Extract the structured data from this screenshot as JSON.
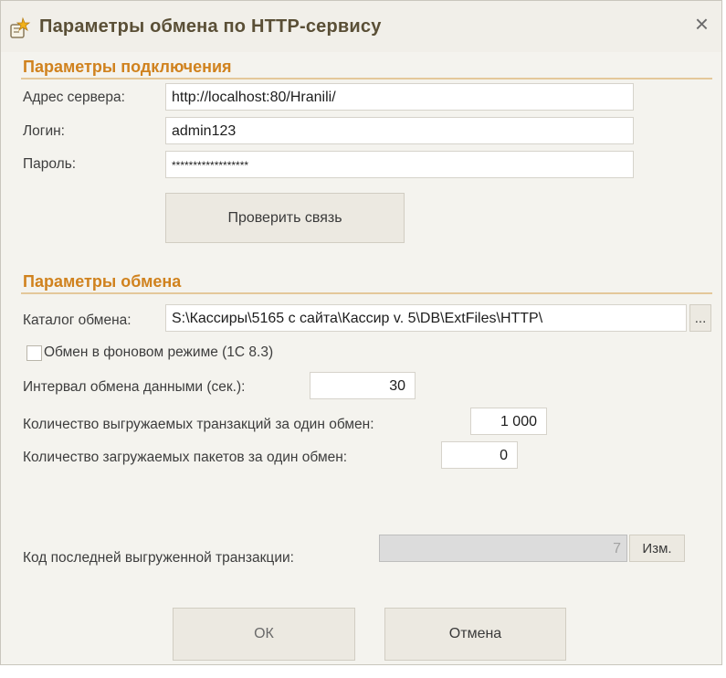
{
  "window": {
    "title": "Параметры обмена по HTTP-сервису",
    "close_label": "×"
  },
  "connection": {
    "section_title": "Параметры подключения",
    "server_label": "Адрес сервера:",
    "server_value": "http://localhost:80/Hranili/",
    "login_label": "Логин:",
    "login_value": "admin123",
    "password_label": "Пароль:",
    "password_value": "******************",
    "check_button": "Проверить связь"
  },
  "exchange": {
    "section_title": "Параметры обмена",
    "catalog_label": "Каталог обмена:",
    "catalog_value": "S:\\Кассиры\\5165 с сайта\\Кассир v. 5\\DB\\ExtFiles\\HTTP\\",
    "browse_button": "...",
    "background_checkbox_label": "Обмен в фоновом режиме (1С 8.3)",
    "background_checked": false,
    "interval_label": "Интервал обмена данными (сек.):",
    "interval_value": "30",
    "upload_count_label": "Количество выгружаемых транзакций за один обмен:",
    "upload_count_value": "1 000",
    "download_count_label": "Количество загружаемых пакетов за один обмен:",
    "download_count_value": "0",
    "last_code_label": "Код последней выгруженной транзакции:",
    "last_code_value": "7",
    "change_button": "Изм."
  },
  "footer": {
    "ok_button": "ОК",
    "cancel_button": "Отмена"
  },
  "colors": {
    "section_accent": "#d0821e",
    "window_bg": "#f4f3ee"
  }
}
